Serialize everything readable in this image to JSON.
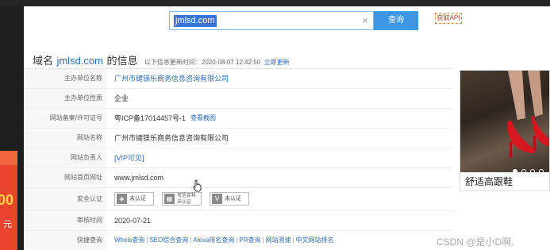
{
  "search": {
    "value": "jmlsd.com",
    "button_label": "查询",
    "api_label": "获取API"
  },
  "header": {
    "prefix": "域名",
    "domain": "jmlsd.com",
    "suffix": "的信息",
    "updated_meta": "以下信息更新时间：2020-08-07 12:42:50",
    "refresh_link": "立即更新"
  },
  "rows": [
    {
      "label": "主办单位名称",
      "value": "广州市键镁乐商务信息咨询有限公司"
    },
    {
      "label": "主办单位性质",
      "value": "企业"
    },
    {
      "label": "网站备案/许可证号",
      "value": "粤ICP备17014457号-1",
      "extra": "查看截图"
    },
    {
      "label": "网站名称",
      "value": "广州市键镁乐商务信息咨询有限公司"
    },
    {
      "label": "网站负责人",
      "value": "[VIP可见]"
    },
    {
      "label": "网站首页网址",
      "value": "www.jmlsd.com"
    },
    {
      "label": "安全认证",
      "value": ""
    },
    {
      "label": "审核时间",
      "value": "2020-07-21"
    },
    {
      "label": "快捷查询",
      "value": ""
    }
  ],
  "badges": [
    {
      "icon": "shield-icon",
      "text": "未认证"
    },
    {
      "icon": "baike-icon",
      "text": "可信百科",
      "text2": "未认证"
    },
    {
      "icon": "v-icon",
      "text": "未认证"
    }
  ],
  "quick_links": [
    "Whois查询",
    "SEO综合查询",
    "Alexa排名查询",
    "PR查询",
    "网站测速",
    "中文网站排名"
  ],
  "ad": {
    "caption": "舒适高跟鞋",
    "active_dot": 1,
    "dot_count": 4
  },
  "left_ad": {
    "number": "00",
    "text": "元"
  },
  "watermark": "CSDN @是小D啊."
}
